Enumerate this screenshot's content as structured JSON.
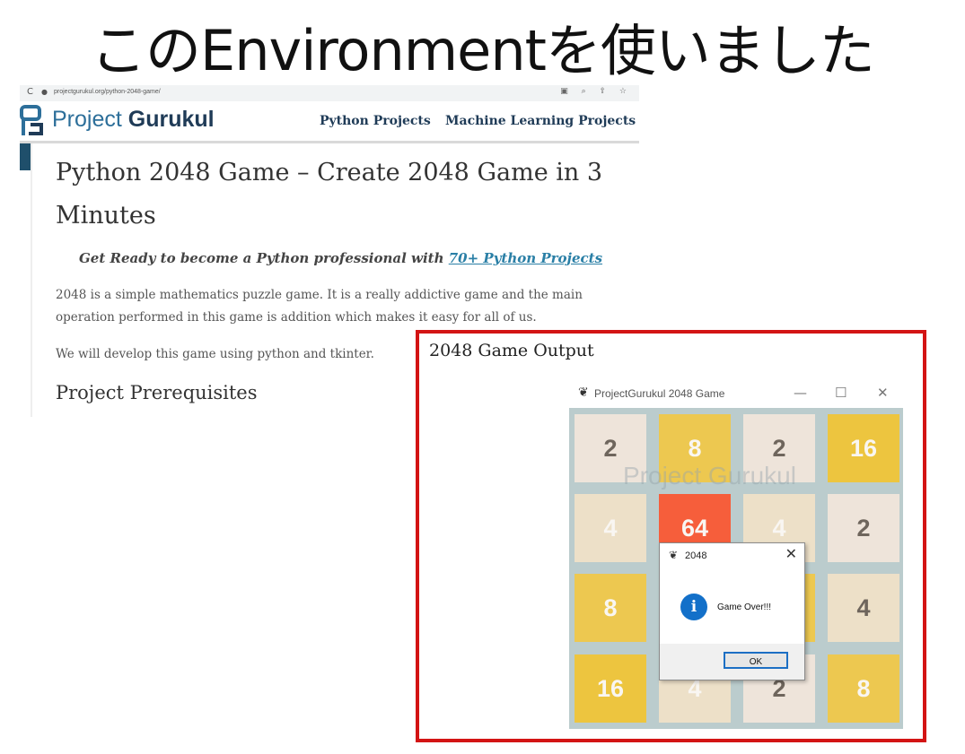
{
  "slide": {
    "title": "このEnvironmentを使いました"
  },
  "browser": {
    "url": "projectgurukul.org/python-2048-game/",
    "reload_icon": "reload-icon",
    "site": {
      "logo_part1": "Project ",
      "logo_part2": "Gurukul",
      "nav": [
        {
          "label": "Python Projects"
        },
        {
          "label": "Machine Learning Projects"
        }
      ]
    },
    "article": {
      "title": "Python 2048 Game – Create 2048 Game in 3 Minutes",
      "promo_text": "Get Ready to become a Python professional with ",
      "promo_link": "70+ Python Projects",
      "para1": "2048 is a simple mathematics puzzle game. It is a really addictive game and the main operation performed in this game is addition which makes it easy for all of us.",
      "para2": "We will develop this game using python and tkinter.",
      "heading2": "Project Prerequisites"
    }
  },
  "output": {
    "label": "2048 Game Output",
    "window": {
      "title": "ProjectGurukul 2048 Game",
      "controls": {
        "minimize": "—",
        "maximize": "☐",
        "close": "✕"
      },
      "watermark": "Project Gurukul"
    },
    "board": [
      [
        "2",
        "8",
        "2",
        "16"
      ],
      [
        "4",
        "64",
        "4",
        "2"
      ],
      [
        "8",
        "",
        "",
        "4"
      ],
      [
        "16",
        "4",
        "2",
        "8"
      ]
    ],
    "colors": {
      "tile_2": "#eee4da",
      "tile_4": "#ede0c8",
      "tile_8": "#edc850",
      "tile_16": "#edc53f",
      "tile_64": "#f65e3b",
      "board": "#bbcccd",
      "dialog_info": "#1370c9",
      "frame_red": "#d31414"
    },
    "dialog": {
      "title": "2048",
      "close": "✕",
      "info_glyph": "i",
      "message": "Game Over!!!",
      "ok_label": "OK"
    }
  }
}
